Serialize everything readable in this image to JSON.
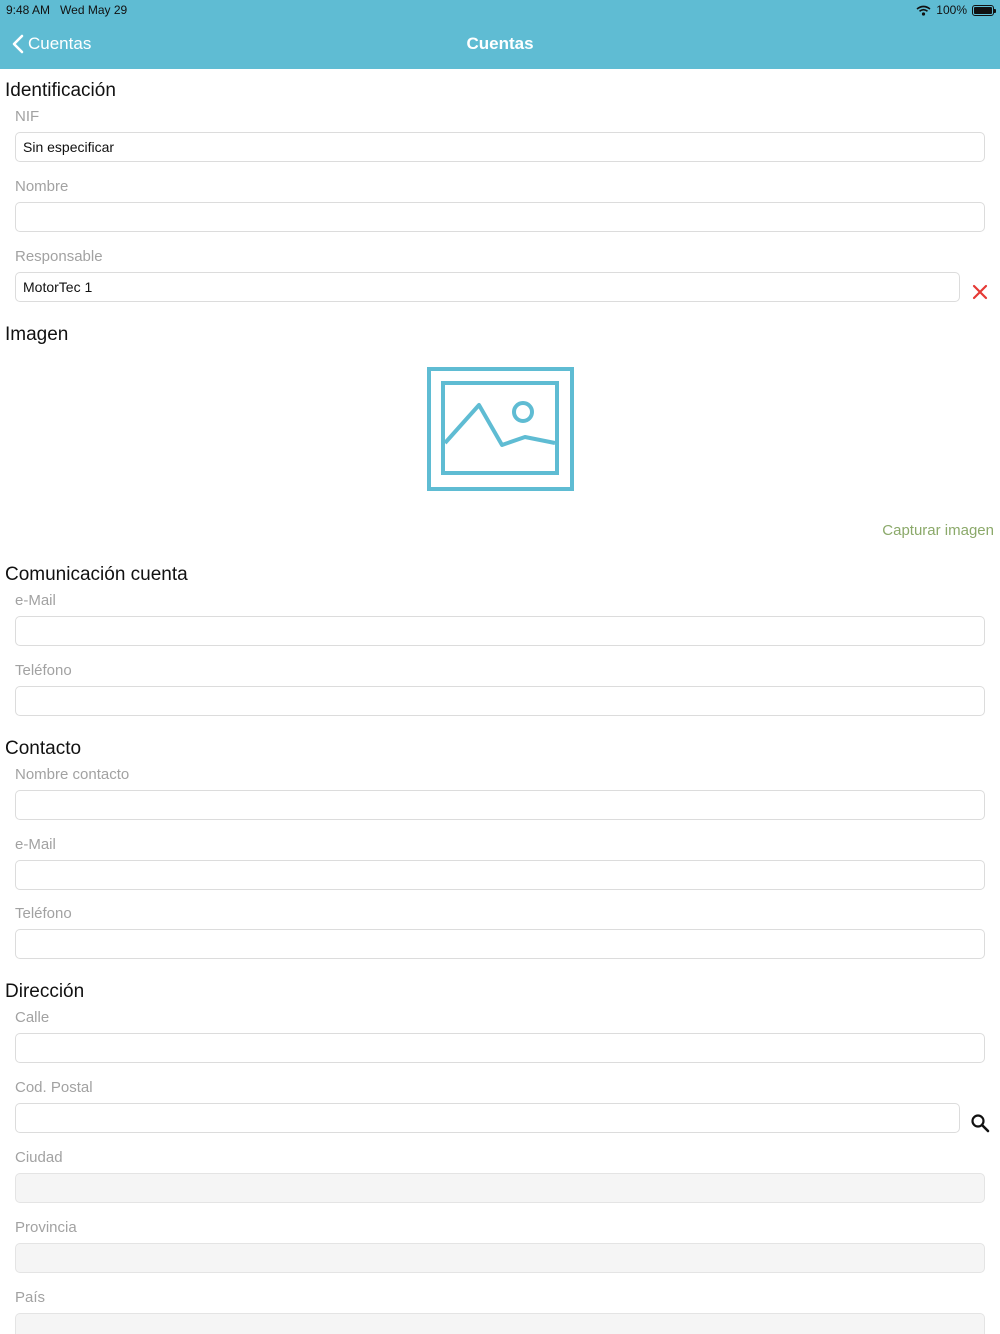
{
  "status_bar": {
    "time": "9:48 AM",
    "date": "Wed May 29",
    "battery": "100%"
  },
  "nav": {
    "back_label": "Cuentas",
    "title": "Cuentas"
  },
  "identificacion": {
    "title": "Identificación",
    "nif_label": "NIF",
    "nif_value": "Sin especificar",
    "nombre_label": "Nombre",
    "nombre_value": "",
    "responsable_label": "Responsable",
    "responsable_value": "MotorTec 1"
  },
  "imagen": {
    "title": "Imagen",
    "capture_label": "Capturar imagen"
  },
  "comunicacion": {
    "title": "Comunicación cuenta",
    "email_label": "e-Mail",
    "email_value": "",
    "telefono_label": "Teléfono",
    "telefono_value": ""
  },
  "contacto": {
    "title": "Contacto",
    "nombre_label": "Nombre contacto",
    "nombre_value": "",
    "email_label": "e-Mail",
    "email_value": "",
    "telefono_label": "Teléfono",
    "telefono_value": ""
  },
  "direccion": {
    "title": "Dirección",
    "calle_label": "Calle",
    "calle_value": "",
    "cp_label": "Cod. Postal",
    "cp_value": "",
    "ciudad_label": "Ciudad",
    "ciudad_value": "",
    "provincia_label": "Provincia",
    "provincia_value": "",
    "pais_label": "País",
    "pais_value": ""
  },
  "colors": {
    "nav_bar": "#5fbcd3",
    "accent_link": "#8ba96a",
    "clear_icon": "#e53935",
    "image_icon": "#5fbcd3"
  },
  "icons": [
    "chevron-left-icon",
    "wifi-icon",
    "battery-icon",
    "close-icon",
    "image-icon",
    "search-icon"
  ]
}
